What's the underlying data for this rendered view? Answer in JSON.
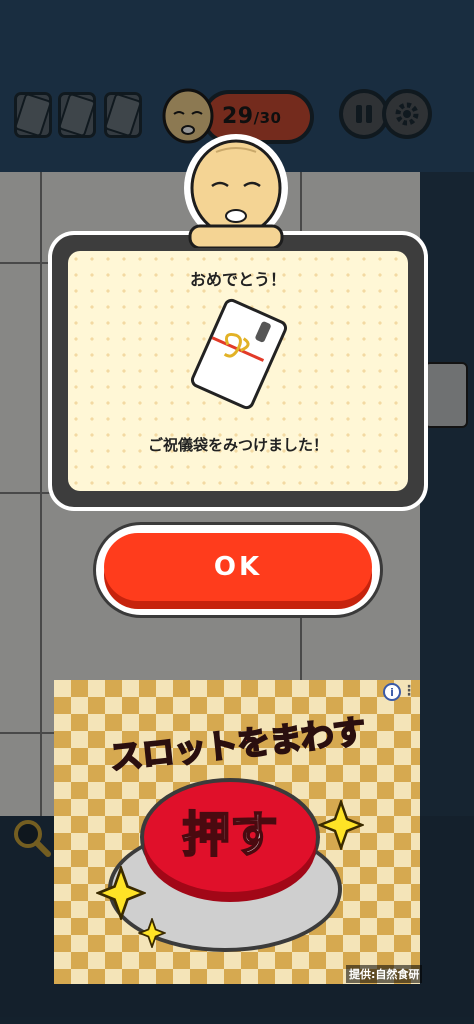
{
  "hud": {
    "found_count": "29",
    "total_count": "/30",
    "pause_icon": "pause-icon",
    "settings_icon": "gear-icon"
  },
  "dialog": {
    "title": "おめでとう！",
    "message": "ご祝儀袋をみつけました！",
    "item_icon": "envelope-icon"
  },
  "ok_button": {
    "label": "OK"
  },
  "ad": {
    "title": "スロットをまわす",
    "button_label": "押す",
    "sponsor": "提供:自然食研",
    "info_icon": "info-icon",
    "more_icon": "more-icon"
  },
  "colors": {
    "ok_red": "#ff3c1c",
    "dialog_bg": "#fff7d6",
    "header_blue": "#2b4f6f"
  }
}
